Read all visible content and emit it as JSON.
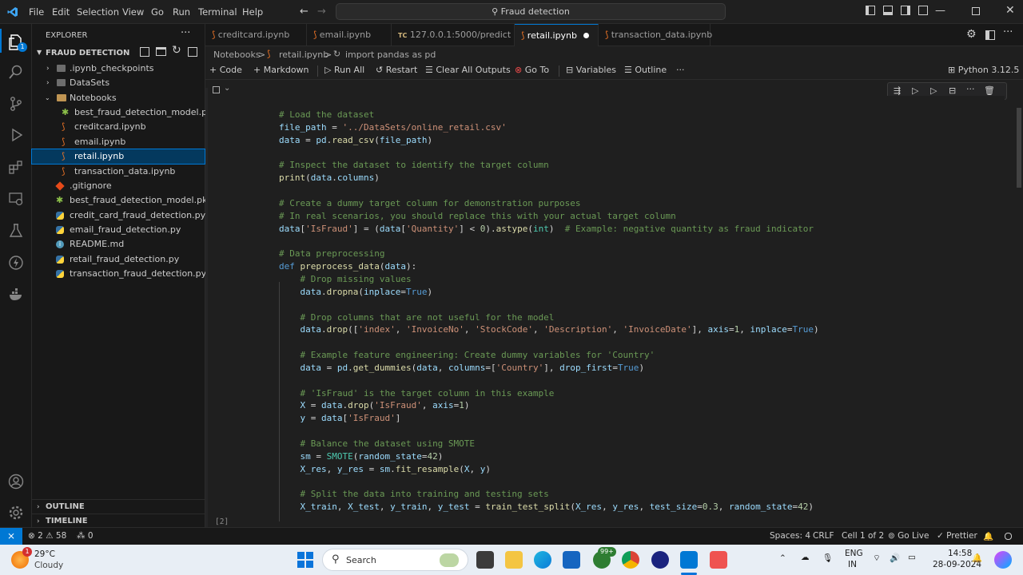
{
  "titlebar": {
    "menu": [
      "File",
      "Edit",
      "Selection",
      "View",
      "Go",
      "Run",
      "Terminal",
      "Help"
    ],
    "search": "Fraud detection"
  },
  "activity": {
    "badge": "1"
  },
  "sidebar": {
    "header": "EXPLORER",
    "folder": "FRAUD DETECTION",
    "items": [
      {
        "label": ".ipynb_checkpoints"
      },
      {
        "label": "DataSets"
      },
      {
        "label": "Notebooks"
      },
      {
        "label": "best_fraud_detection_model.pkl"
      },
      {
        "label": "creditcard.ipynb"
      },
      {
        "label": "email.ipynb"
      },
      {
        "label": "retail.ipynb"
      },
      {
        "label": "transaction_data.ipynb"
      },
      {
        "label": ".gitignore"
      },
      {
        "label": "best_fraud_detection_model.pkl"
      },
      {
        "label": "credit_card_fraud_detection.py"
      },
      {
        "label": "email_fraud_detection.py"
      },
      {
        "label": "README.md"
      },
      {
        "label": "retail_fraud_detection.py"
      },
      {
        "label": "transaction_fraud_detection.py"
      }
    ],
    "outline": "OUTLINE",
    "timeline": "TIMELINE"
  },
  "tabs": [
    {
      "label": "creditcard.ipynb"
    },
    {
      "label": "email.ipynb"
    },
    {
      "label": "127.0.0.1:5000/predict",
      "prefix": "TC"
    },
    {
      "label": "retail.ipynb"
    },
    {
      "label": "transaction_data.ipynb"
    }
  ],
  "breadcrumb": {
    "a": "Notebooks",
    "sep": ">",
    "b": "retail.ipynb",
    "c": "import pandas as pd"
  },
  "toolbar": {
    "code": "Code",
    "markdown": "Markdown",
    "run_all": "Run All",
    "restart": "Restart",
    "clear": "Clear All Outputs",
    "goto": "Go To",
    "variables": "Variables",
    "outline": "Outline",
    "kernel": "Python 3.12.5"
  },
  "cell": {
    "exec_count": "[2]"
  },
  "status": {
    "errors": "2",
    "warnings": "58",
    "ports": "0",
    "spaces": "Spaces: 4",
    "eol": "CRLF",
    "cell": "Cell 1 of 2",
    "golive": "Go Live",
    "prettier": "Prettier"
  },
  "taskbar": {
    "temp": "29°C",
    "weather": "Cloudy",
    "weather_badge": "1",
    "search": "Search",
    "store_badge": "99+",
    "lang1": "ENG",
    "lang2": "IN",
    "time": "14:58",
    "date": "28-09-2024"
  },
  "colors": {
    "accent": "#0078d4",
    "remote": "#0078d4",
    "selection": "#04395e"
  }
}
